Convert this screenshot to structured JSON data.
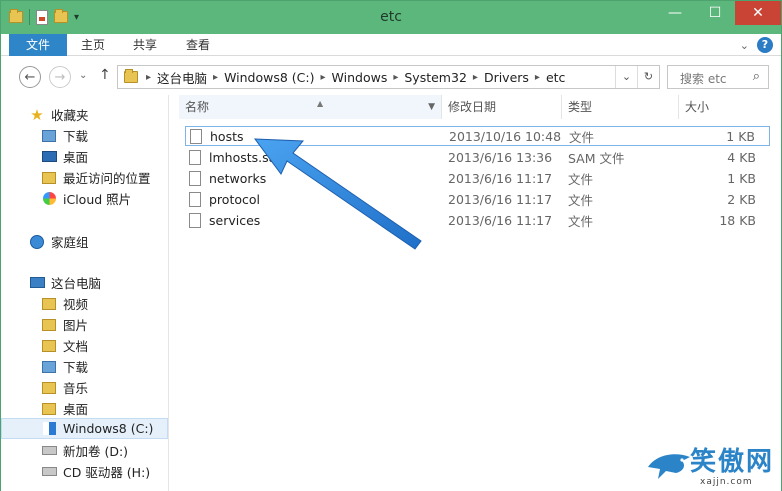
{
  "window": {
    "title": "etc",
    "minimize_glyph": "—",
    "maximize_glyph": "☐",
    "close_glyph": "✕"
  },
  "quick_access": {
    "icons": [
      "folder-icon",
      "properties-icon",
      "new-folder-icon",
      "customize-dropdown-icon"
    ]
  },
  "ribbon": {
    "tabs": [
      {
        "label": "文件",
        "active": true
      },
      {
        "label": "主页"
      },
      {
        "label": "共享"
      },
      {
        "label": "查看"
      }
    ],
    "collapse_glyph": "⌄",
    "help_glyph": "?"
  },
  "navigation": {
    "back_glyph": "←",
    "forward_glyph": "→",
    "recent_glyph": "⌄",
    "up_glyph": "↑",
    "breadcrumbs": [
      "这台电脑",
      "Windows8 (C:)",
      "Windows",
      "System32",
      "Drivers",
      "etc"
    ],
    "breadcrumb_sep": "▸",
    "history_glyph": "⌄",
    "refresh_glyph": "↻",
    "search_placeholder": "搜索 etc",
    "search_glyph": "⌕"
  },
  "sidebar": {
    "favorites": {
      "label": "收藏夹",
      "items": [
        {
          "label": "下载",
          "icon": "downloads-folder-icon"
        },
        {
          "label": "桌面",
          "icon": "desktop-icon"
        },
        {
          "label": "最近访问的位置",
          "icon": "recent-places-icon"
        },
        {
          "label": "iCloud 照片",
          "icon": "icloud-photos-icon"
        }
      ]
    },
    "homegroup": {
      "label": "家庭组"
    },
    "this_pc": {
      "label": "这台电脑",
      "items": [
        {
          "label": "视频",
          "icon": "videos-folder-icon"
        },
        {
          "label": "图片",
          "icon": "pictures-folder-icon"
        },
        {
          "label": "文档",
          "icon": "documents-folder-icon"
        },
        {
          "label": "下载",
          "icon": "downloads-folder-icon"
        },
        {
          "label": "音乐",
          "icon": "music-folder-icon"
        },
        {
          "label": "桌面",
          "icon": "desktop-folder-icon"
        },
        {
          "label": "Windows8 (C:)",
          "icon": "windows-drive-icon",
          "selected": true
        },
        {
          "label": "新加卷 (D:)",
          "icon": "drive-icon"
        },
        {
          "label": "CD 驱动器 (H:)",
          "icon": "cd-drive-icon"
        }
      ]
    }
  },
  "file_list": {
    "columns": {
      "name": "名称",
      "date": "修改日期",
      "type": "类型",
      "size": "大小"
    },
    "rows": [
      {
        "name": "hosts",
        "date": "2013/10/16 10:48",
        "type": "文件",
        "size": "1 KB",
        "selected": true
      },
      {
        "name": "lmhosts.sam",
        "date": "2013/6/16 13:36",
        "type": "SAM 文件",
        "size": "4 KB"
      },
      {
        "name": "networks",
        "date": "2013/6/16 11:17",
        "type": "文件",
        "size": "1 KB"
      },
      {
        "name": "protocol",
        "date": "2013/6/16 11:17",
        "type": "文件",
        "size": "2 KB"
      },
      {
        "name": "services",
        "date": "2013/6/16 11:17",
        "type": "文件",
        "size": "18 KB"
      }
    ]
  },
  "watermark": {
    "text": "笑傲网",
    "subtext": "xajjn.com"
  },
  "colors": {
    "titlebar": "#5cb77c",
    "file_tab": "#2e86c9",
    "close_button": "#c94434",
    "arrow": "#2f86e0"
  }
}
